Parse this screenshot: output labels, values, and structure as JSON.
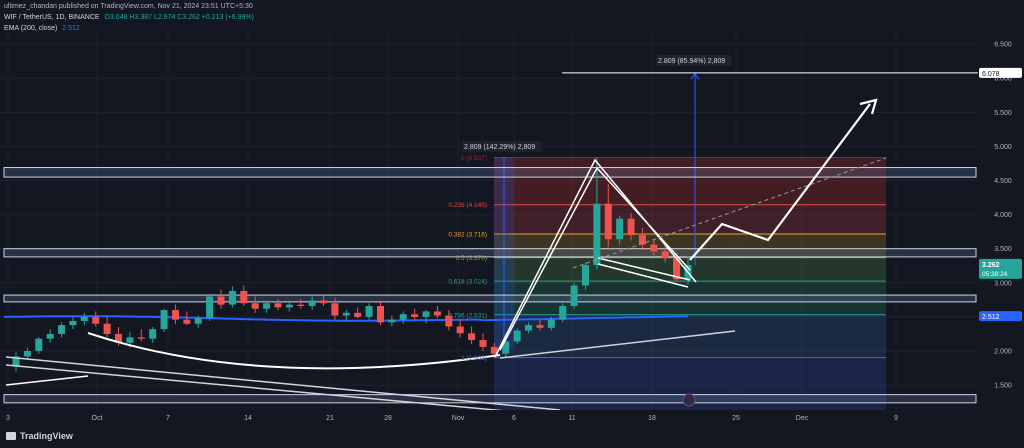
{
  "header": {
    "publish_line": "ultimez_chandan published on TradingView.com, Nov 21, 2024 23:51 UTC+5:30",
    "symbol": "WIF / TetherUS, 1D, BINANCE",
    "ohlc": "O3.048  H3.387  L2.974  C3.262  +0.213 (+6.99%)",
    "indicator_name": "EMA (200, close)",
    "indicator_value": "2.512"
  },
  "chart_data": {
    "type": "candlestick",
    "yticks": [
      "6.500",
      "6.000",
      "5.500",
      "5.000",
      "4.500",
      "4.000",
      "3.500",
      "3.000",
      "2.500",
      "2.000",
      "1.500",
      "1.000"
    ],
    "yrange": [
      1.0,
      6.75
    ],
    "xticks": [
      "3",
      "Oct",
      "7",
      "14",
      "21",
      "28",
      "Nov",
      "6",
      "11",
      "18",
      "25",
      "Dec",
      "9"
    ],
    "current_price": "3.262",
    "countdown": "05:38:24",
    "ema_value": "2.512",
    "target_label": "6.078",
    "fib_levels": [
      {
        "label": "0 (4.837)",
        "value": 4.837,
        "color": "#9c2727"
      },
      {
        "label": "0.236 (4.145)",
        "value": 4.145,
        "color": "#e04a4a"
      },
      {
        "label": "0.382 (3.716)",
        "value": 3.716,
        "color": "#f0a030"
      },
      {
        "label": "0.5 (3.370)",
        "value": 3.37,
        "color": "#7cb85a"
      },
      {
        "label": "0.618 (3.024)",
        "value": 3.024,
        "color": "#2aa56a"
      },
      {
        "label": "0.786 (2.531)",
        "value": 2.531,
        "color": "#26a69a"
      },
      {
        "label": "1 (1.903)",
        "value": 1.903,
        "color": "#4a6dba"
      }
    ],
    "measure_1": "2.809 (142.29%) 2,809",
    "measure_2": "2.809 (85.94%) 2,809",
    "candles": [
      {
        "o": 1.78,
        "h": 1.98,
        "l": 1.7,
        "c": 1.92
      },
      {
        "o": 1.92,
        "h": 2.05,
        "l": 1.88,
        "c": 2.0
      },
      {
        "o": 2.0,
        "h": 2.2,
        "l": 1.96,
        "c": 2.18
      },
      {
        "o": 2.18,
        "h": 2.32,
        "l": 2.12,
        "c": 2.25
      },
      {
        "o": 2.25,
        "h": 2.42,
        "l": 2.2,
        "c": 2.38
      },
      {
        "o": 2.38,
        "h": 2.5,
        "l": 2.32,
        "c": 2.44
      },
      {
        "o": 2.44,
        "h": 2.56,
        "l": 2.38,
        "c": 2.5
      },
      {
        "o": 2.5,
        "h": 2.58,
        "l": 2.36,
        "c": 2.4
      },
      {
        "o": 2.4,
        "h": 2.52,
        "l": 2.2,
        "c": 2.25
      },
      {
        "o": 2.25,
        "h": 2.35,
        "l": 2.08,
        "c": 2.12
      },
      {
        "o": 2.12,
        "h": 2.28,
        "l": 2.05,
        "c": 2.2
      },
      {
        "o": 2.2,
        "h": 2.32,
        "l": 2.14,
        "c": 2.18
      },
      {
        "o": 2.18,
        "h": 2.35,
        "l": 2.12,
        "c": 2.32
      },
      {
        "o": 2.32,
        "h": 2.62,
        "l": 2.28,
        "c": 2.6
      },
      {
        "o": 2.6,
        "h": 2.68,
        "l": 2.4,
        "c": 2.46
      },
      {
        "o": 2.46,
        "h": 2.58,
        "l": 2.38,
        "c": 2.4
      },
      {
        "o": 2.4,
        "h": 2.52,
        "l": 2.34,
        "c": 2.48
      },
      {
        "o": 2.48,
        "h": 2.84,
        "l": 2.44,
        "c": 2.8
      },
      {
        "o": 2.8,
        "h": 2.9,
        "l": 2.62,
        "c": 2.68
      },
      {
        "o": 2.68,
        "h": 2.95,
        "l": 2.64,
        "c": 2.88
      },
      {
        "o": 2.88,
        "h": 2.96,
        "l": 2.66,
        "c": 2.7
      },
      {
        "o": 2.7,
        "h": 2.8,
        "l": 2.56,
        "c": 2.62
      },
      {
        "o": 2.62,
        "h": 2.74,
        "l": 2.56,
        "c": 2.7
      },
      {
        "o": 2.7,
        "h": 2.76,
        "l": 2.6,
        "c": 2.64
      },
      {
        "o": 2.64,
        "h": 2.74,
        "l": 2.58,
        "c": 2.68
      },
      {
        "o": 2.68,
        "h": 2.76,
        "l": 2.62,
        "c": 2.66
      },
      {
        "o": 2.66,
        "h": 2.8,
        "l": 2.6,
        "c": 2.74
      },
      {
        "o": 2.74,
        "h": 2.82,
        "l": 2.66,
        "c": 2.7
      },
      {
        "o": 2.7,
        "h": 2.78,
        "l": 2.46,
        "c": 2.52
      },
      {
        "o": 2.52,
        "h": 2.6,
        "l": 2.44,
        "c": 2.56
      },
      {
        "o": 2.56,
        "h": 2.64,
        "l": 2.48,
        "c": 2.5
      },
      {
        "o": 2.5,
        "h": 2.7,
        "l": 2.46,
        "c": 2.66
      },
      {
        "o": 2.66,
        "h": 2.72,
        "l": 2.38,
        "c": 2.42
      },
      {
        "o": 2.42,
        "h": 2.52,
        "l": 2.36,
        "c": 2.46
      },
      {
        "o": 2.46,
        "h": 2.58,
        "l": 2.4,
        "c": 2.54
      },
      {
        "o": 2.54,
        "h": 2.62,
        "l": 2.46,
        "c": 2.5
      },
      {
        "o": 2.5,
        "h": 2.6,
        "l": 2.4,
        "c": 2.58
      },
      {
        "o": 2.58,
        "h": 2.66,
        "l": 2.48,
        "c": 2.52
      },
      {
        "o": 2.52,
        "h": 2.6,
        "l": 2.3,
        "c": 2.36
      },
      {
        "o": 2.36,
        "h": 2.46,
        "l": 2.2,
        "c": 2.26
      },
      {
        "o": 2.26,
        "h": 2.36,
        "l": 2.1,
        "c": 2.16
      },
      {
        "o": 2.16,
        "h": 2.26,
        "l": 2.0,
        "c": 2.06
      },
      {
        "o": 2.06,
        "h": 2.12,
        "l": 1.9,
        "c": 1.96
      },
      {
        "o": 1.96,
        "h": 2.18,
        "l": 1.92,
        "c": 2.14
      },
      {
        "o": 2.14,
        "h": 2.34,
        "l": 2.1,
        "c": 2.3
      },
      {
        "o": 2.3,
        "h": 2.42,
        "l": 2.26,
        "c": 2.38
      },
      {
        "o": 2.38,
        "h": 2.46,
        "l": 2.3,
        "c": 2.34
      },
      {
        "o": 2.34,
        "h": 2.5,
        "l": 2.3,
        "c": 2.46
      },
      {
        "o": 2.46,
        "h": 2.7,
        "l": 2.42,
        "c": 2.66
      },
      {
        "o": 2.66,
        "h": 3.0,
        "l": 2.62,
        "c": 2.96
      },
      {
        "o": 2.96,
        "h": 3.3,
        "l": 2.9,
        "c": 3.26
      },
      {
        "o": 3.26,
        "h": 4.84,
        "l": 3.2,
        "c": 4.16
      },
      {
        "o": 4.16,
        "h": 4.45,
        "l": 3.52,
        "c": 3.64
      },
      {
        "o": 3.64,
        "h": 3.98,
        "l": 3.56,
        "c": 3.94
      },
      {
        "o": 3.94,
        "h": 4.02,
        "l": 3.62,
        "c": 3.7
      },
      {
        "o": 3.7,
        "h": 3.8,
        "l": 3.48,
        "c": 3.56
      },
      {
        "o": 3.56,
        "h": 3.64,
        "l": 3.4,
        "c": 3.46
      },
      {
        "o": 3.46,
        "h": 3.54,
        "l": 3.3,
        "c": 3.36
      },
      {
        "o": 3.36,
        "h": 3.44,
        "l": 3.02,
        "c": 3.05
      },
      {
        "o": 3.048,
        "h": 3.387,
        "l": 2.974,
        "c": 3.262
      }
    ]
  },
  "footer": {
    "brand": "TradingView"
  }
}
